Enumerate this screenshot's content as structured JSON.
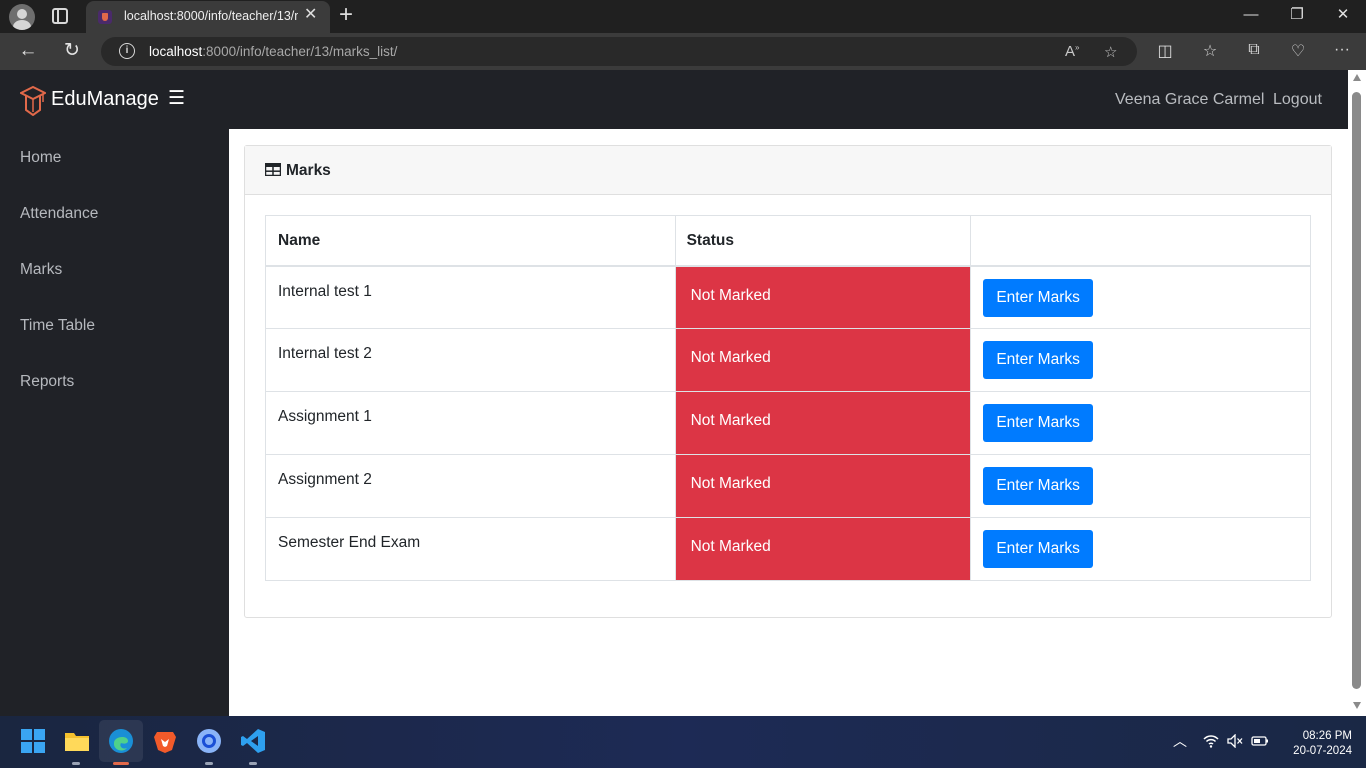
{
  "browser": {
    "tab_title": "localhost:8000/info/teacher/13/m",
    "url_host": "localhost",
    "url_rest": ":8000/info/teacher/13/marks_list/"
  },
  "app": {
    "brand": "EduManage",
    "user_name": "Veena Grace Carmel",
    "logout_label": "Logout"
  },
  "sidebar": {
    "items": [
      {
        "label": "Home"
      },
      {
        "label": "Attendance"
      },
      {
        "label": "Marks"
      },
      {
        "label": "Time Table"
      },
      {
        "label": "Reports"
      }
    ]
  },
  "card": {
    "title": "Marks",
    "columns": [
      "Name",
      "Status",
      ""
    ],
    "rows": [
      {
        "name": "Internal test 1",
        "status": "Not Marked",
        "action": "Enter Marks"
      },
      {
        "name": "Internal test 2",
        "status": "Not Marked",
        "action": "Enter Marks"
      },
      {
        "name": "Assignment 1",
        "status": "Not Marked",
        "action": "Enter Marks"
      },
      {
        "name": "Assignment 2",
        "status": "Not Marked",
        "action": "Enter Marks"
      },
      {
        "name": "Semester End Exam",
        "status": "Not Marked",
        "action": "Enter Marks"
      }
    ]
  },
  "colors": {
    "status_not_marked": "#dc3545",
    "primary_button": "#007bff",
    "app_dark": "#202227"
  },
  "taskbar": {
    "time": "08:26 PM",
    "date": "20-07-2024"
  }
}
